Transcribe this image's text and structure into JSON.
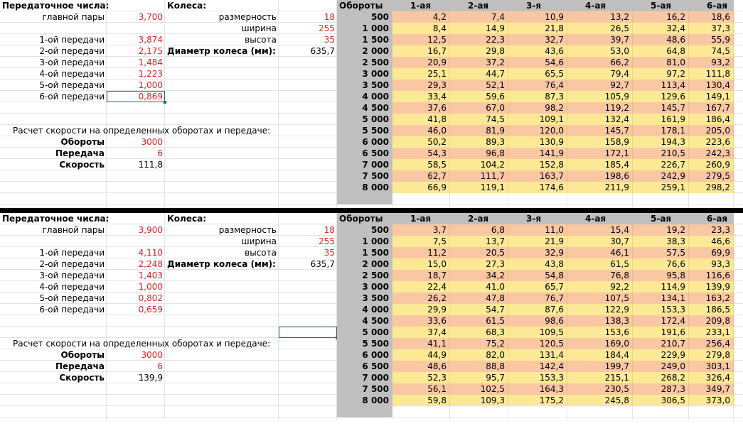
{
  "blocks": [
    {
      "gear_title": "Передаточное числа:",
      "wheel_title": "Колеса:",
      "main_pair_label": "главной пары",
      "main_pair_value": "3,700",
      "gears": [
        {
          "label": "1-ой передачи",
          "value": "3,874"
        },
        {
          "label": "2-ой передачи",
          "value": "2,175"
        },
        {
          "label": "3-ой передачи",
          "value": "1,484"
        },
        {
          "label": "4-ой передачи",
          "value": "1,223"
        },
        {
          "label": "5-ой передачи",
          "value": "1,000"
        },
        {
          "label": "6-ой передачи",
          "value": "0,869"
        }
      ],
      "wheel": {
        "size_label": "размерность",
        "size_value": "18",
        "width_label": "ширина",
        "width_value": "255",
        "height_label": "высота",
        "height_value": "35",
        "diameter_label": "Диаметр колеса (мм):",
        "diameter_value": "635,7"
      },
      "calc": {
        "title": "Расчет скорости на определенных оборотах и передаче:",
        "rpm_label": "Обороты",
        "rpm_value": "3000",
        "gear_label": "Передача",
        "gear_value": "6",
        "speed_label": "Скорость",
        "speed_value": "111,8"
      },
      "table": {
        "rpm_header": "Обороты",
        "gear_headers": [
          "1-ая",
          "2-ая",
          "3-я",
          "4-ая",
          "5-ая",
          "6-ая"
        ],
        "rows": [
          {
            "rpm": "500",
            "values": [
              "4,2",
              "7,4",
              "10,9",
              "13,2",
              "16,2",
              "18,6"
            ]
          },
          {
            "rpm": "1 000",
            "values": [
              "8,4",
              "14,9",
              "21,8",
              "26,5",
              "32,4",
              "37,3"
            ]
          },
          {
            "rpm": "1 500",
            "values": [
              "12,5",
              "22,3",
              "32,7",
              "39,7",
              "48,6",
              "55,9"
            ]
          },
          {
            "rpm": "2 000",
            "values": [
              "16,7",
              "29,8",
              "43,6",
              "53,0",
              "64,8",
              "74,5"
            ]
          },
          {
            "rpm": "2 500",
            "values": [
              "20,9",
              "37,2",
              "54,6",
              "66,2",
              "81,0",
              "93,2"
            ]
          },
          {
            "rpm": "3 000",
            "values": [
              "25,1",
              "44,7",
              "65,5",
              "79,4",
              "97,2",
              "111,8"
            ]
          },
          {
            "rpm": "3 500",
            "values": [
              "29,3",
              "52,1",
              "76,4",
              "92,7",
              "113,4",
              "130,4"
            ]
          },
          {
            "rpm": "4 000",
            "values": [
              "33,4",
              "59,6",
              "87,3",
              "105,9",
              "129,6",
              "149,1"
            ]
          },
          {
            "rpm": "4 500",
            "values": [
              "37,6",
              "67,0",
              "98,2",
              "119,2",
              "145,7",
              "167,7"
            ]
          },
          {
            "rpm": "5 000",
            "values": [
              "41,8",
              "74,5",
              "109,1",
              "132,4",
              "161,9",
              "186,4"
            ]
          },
          {
            "rpm": "5 500",
            "values": [
              "46,0",
              "81,9",
              "120,0",
              "145,7",
              "178,1",
              "205,0"
            ]
          },
          {
            "rpm": "6 000",
            "values": [
              "50,2",
              "89,3",
              "130,9",
              "158,9",
              "194,3",
              "223,6"
            ]
          },
          {
            "rpm": "6 500",
            "values": [
              "54,3",
              "96,8",
              "141,9",
              "172,1",
              "210,5",
              "242,3"
            ]
          },
          {
            "rpm": "7 000",
            "values": [
              "58,5",
              "104,2",
              "152,8",
              "185,4",
              "226,7",
              "260,9"
            ]
          },
          {
            "rpm": "7 500",
            "values": [
              "62,7",
              "111,7",
              "163,7",
              "198,6",
              "242,9",
              "279,5"
            ]
          },
          {
            "rpm": "8 000",
            "values": [
              "66,9",
              "119,1",
              "174,6",
              "211,9",
              "259,1",
              "298,2"
            ]
          }
        ]
      }
    },
    {
      "gear_title": "Передаточное числа:",
      "wheel_title": "Колеса:",
      "main_pair_label": "главной пары",
      "main_pair_value": "3,900",
      "gears": [
        {
          "label": "1-ой передачи",
          "value": "4,110"
        },
        {
          "label": "2-ой передачи",
          "value": "2,248"
        },
        {
          "label": "3-ой передачи",
          "value": "1,403"
        },
        {
          "label": "4-ой передачи",
          "value": "1,000"
        },
        {
          "label": "5-ой передачи",
          "value": "0,802"
        },
        {
          "label": "6-ой передачи",
          "value": "0,659"
        }
      ],
      "wheel": {
        "size_label": "размерность",
        "size_value": "18",
        "width_label": "ширина",
        "width_value": "255",
        "height_label": "высота",
        "height_value": "35",
        "diameter_label": "Диаметр колеса (мм):",
        "diameter_value": "635,7"
      },
      "calc": {
        "title": "Расчет скорости на определенных оборотах и передаче:",
        "rpm_label": "Обороты",
        "rpm_value": "3000",
        "gear_label": "Передача",
        "gear_value": "6",
        "speed_label": "Скорость",
        "speed_value": "139,9"
      },
      "table": {
        "rpm_header": "Обороты",
        "gear_headers": [
          "1-ая",
          "2-ая",
          "3-я",
          "4-ая",
          "5-ая",
          "6-ая"
        ],
        "rows": [
          {
            "rpm": "500",
            "values": [
              "3,7",
              "6,8",
              "11,0",
              "15,4",
              "19,2",
              "23,3"
            ]
          },
          {
            "rpm": "1 000",
            "values": [
              "7,5",
              "13,7",
              "21,9",
              "30,7",
              "38,3",
              "46,6"
            ]
          },
          {
            "rpm": "1 500",
            "values": [
              "11,2",
              "20,5",
              "32,9",
              "46,1",
              "57,5",
              "69,9"
            ]
          },
          {
            "rpm": "2 000",
            "values": [
              "15,0",
              "27,3",
              "43,8",
              "61,5",
              "76,6",
              "93,3"
            ]
          },
          {
            "rpm": "2 500",
            "values": [
              "18,7",
              "34,2",
              "54,8",
              "76,8",
              "95,8",
              "116,6"
            ]
          },
          {
            "rpm": "3 000",
            "values": [
              "22,4",
              "41,0",
              "65,7",
              "92,2",
              "114,9",
              "139,9"
            ]
          },
          {
            "rpm": "3 500",
            "values": [
              "26,2",
              "47,8",
              "76,7",
              "107,5",
              "134,1",
              "163,2"
            ]
          },
          {
            "rpm": "4 000",
            "values": [
              "29,9",
              "54,7",
              "87,6",
              "122,9",
              "153,3",
              "186,5"
            ]
          },
          {
            "rpm": "4 500",
            "values": [
              "33,6",
              "61,5",
              "98,6",
              "138,3",
              "172,4",
              "209,8"
            ]
          },
          {
            "rpm": "5 000",
            "values": [
              "37,4",
              "68,3",
              "109,5",
              "153,6",
              "191,6",
              "233,1"
            ]
          },
          {
            "rpm": "5 500",
            "values": [
              "41,1",
              "75,2",
              "120,5",
              "169,0",
              "210,7",
              "256,4"
            ]
          },
          {
            "rpm": "6 000",
            "values": [
              "44,9",
              "82,0",
              "131,4",
              "184,4",
              "229,9",
              "279,8"
            ]
          },
          {
            "rpm": "6 500",
            "values": [
              "48,6",
              "88,8",
              "142,4",
              "199,7",
              "249,0",
              "303,1"
            ]
          },
          {
            "rpm": "7 000",
            "values": [
              "52,3",
              "95,7",
              "153,3",
              "215,1",
              "268,2",
              "326,4"
            ]
          },
          {
            "rpm": "7 500",
            "values": [
              "56,1",
              "102,5",
              "164,3",
              "230,5",
              "287,3",
              "349,7"
            ]
          },
          {
            "rpm": "8 000",
            "values": [
              "59,8",
              "109,3",
              "175,2",
              "245,8",
              "306,5",
              "373,0"
            ]
          }
        ]
      }
    }
  ]
}
